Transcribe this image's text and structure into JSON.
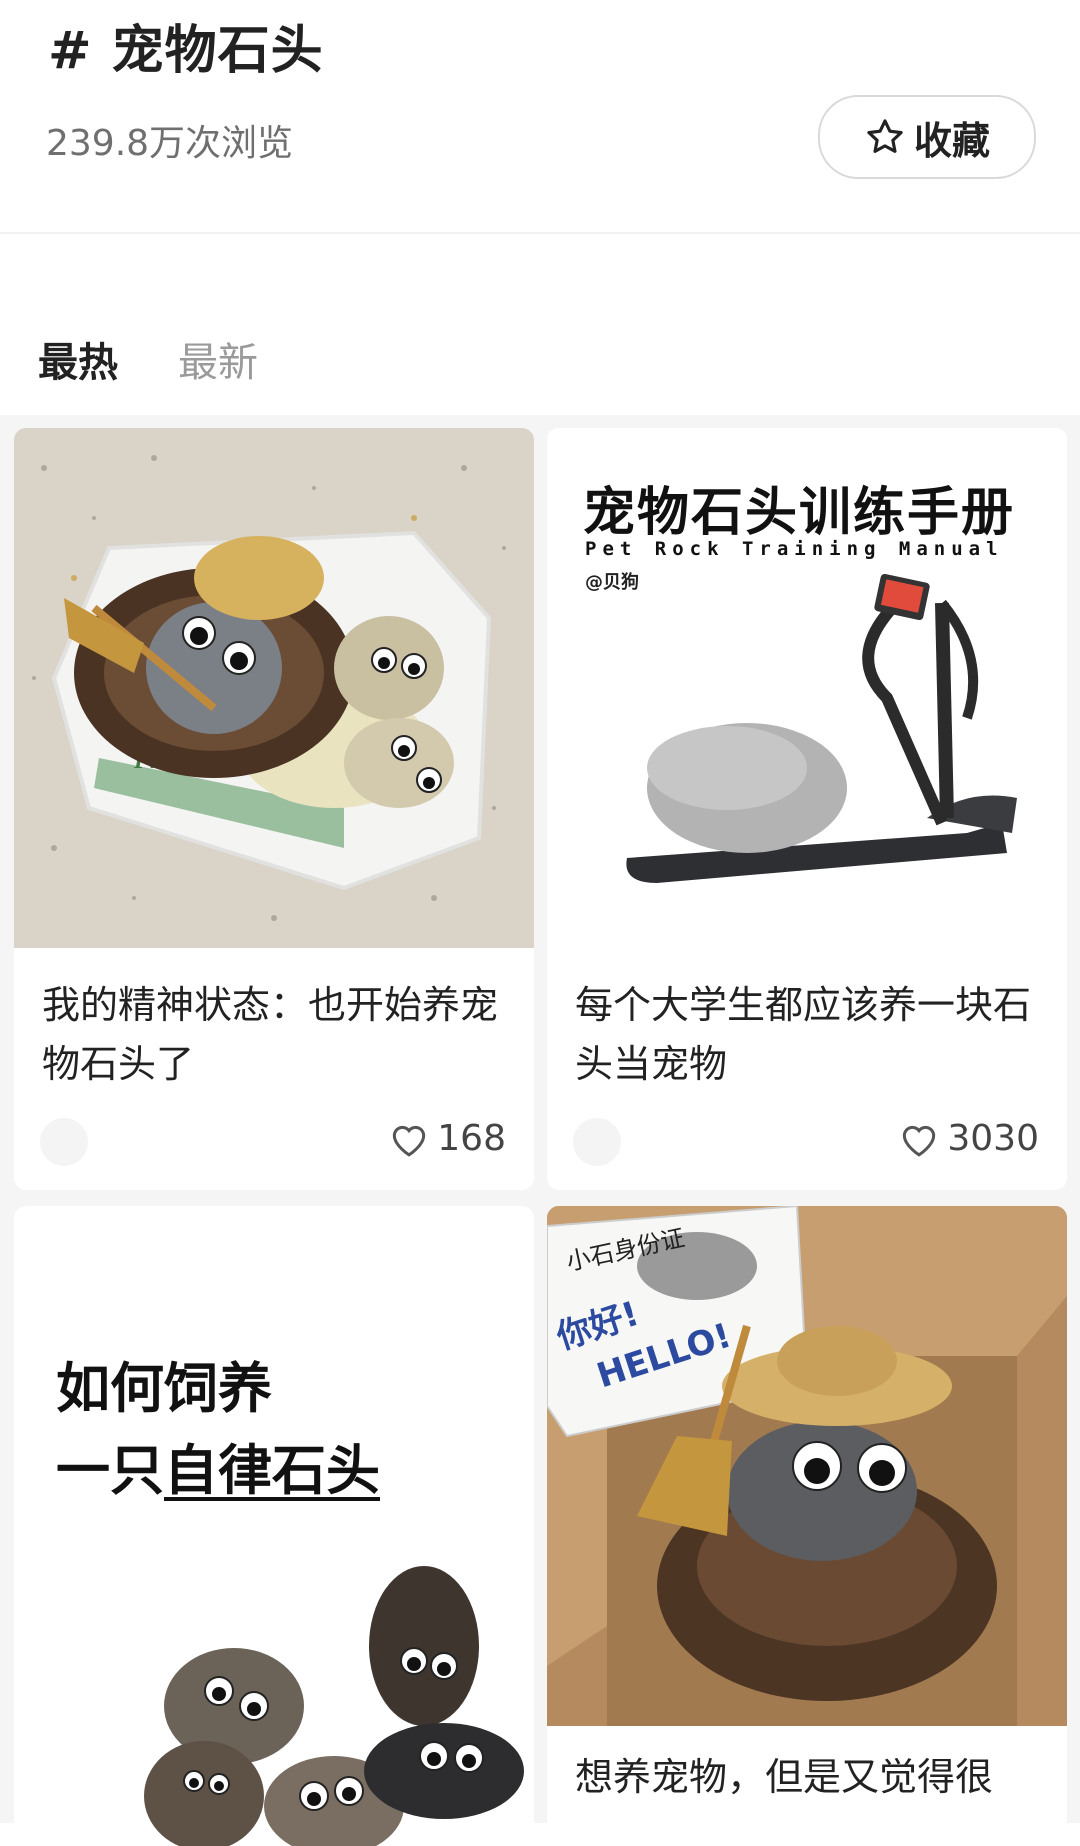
{
  "header": {
    "title": "# 宠物石头",
    "views": "239.8万次浏览",
    "favorite_label": "收藏"
  },
  "tabs": [
    {
      "label": "最热",
      "active": true
    },
    {
      "label": "最新",
      "active": false
    }
  ],
  "cards": [
    {
      "title": "我的精神状态：也开始养宠物石头了",
      "likes": "168"
    },
    {
      "title": "每个大学生都应该养一块石头当宠物",
      "likes": "3030",
      "poster": {
        "title": "宠物石头训练手册",
        "subtitle": "Pet Rock Training Manual",
        "author": "@贝狗"
      }
    },
    {
      "poster": {
        "line1": "如何饲养",
        "line2_prefix": "一只",
        "line2_underlined": "自律石头"
      }
    },
    {
      "title": "想养宠物，但是又觉得很",
      "poster": {
        "card_title": "小石身份证",
        "greeting_cn": "你好!",
        "greeting_en": "HELLO!"
      }
    }
  ],
  "colors": {
    "accent": "#222222",
    "muted": "#9a9a9a",
    "feed_bg": "#f5f5f5"
  }
}
